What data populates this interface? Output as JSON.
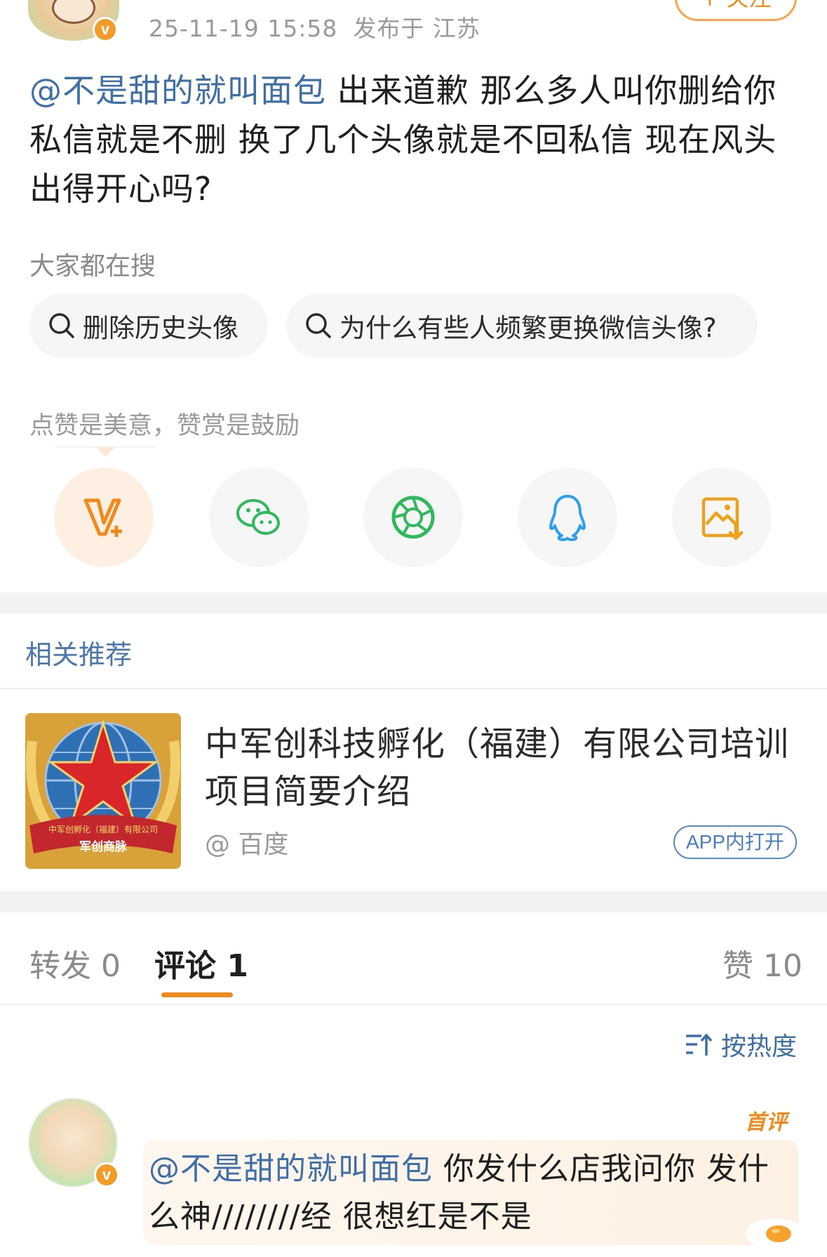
{
  "post": {
    "meta_time": "25-11-19 15:58",
    "meta_location": "发布于 江苏",
    "follow_label": "+ 关注",
    "mention": "@不是甜的就叫面包",
    "body": " 出来道歉 那么多人叫你删给你私信就是不删 换了几个头像就是不回私信 现在风头出得开心吗?"
  },
  "search": {
    "title": "大家都在搜",
    "chips": [
      {
        "label": "删除历史头像",
        "icon": "search-icon"
      },
      {
        "label": "为什么有些人频繁更换微信头像?",
        "icon": "search-icon"
      }
    ]
  },
  "reward": {
    "title": "点赞是美意，赞赏是鼓励",
    "share_icons": [
      "v-plus-icon",
      "wechat-icon",
      "moments-icon",
      "qq-icon",
      "save-image-icon"
    ]
  },
  "related": {
    "title": "相关推荐",
    "card": {
      "title": "中军创科技孵化（福建）有限公司培训项目简要介绍",
      "source": "@ 百度",
      "open_label": "APP内打开",
      "thumb_banner": "中军创孵化（福建）有限公司",
      "thumb_label": "军创商脉"
    }
  },
  "tabs": {
    "repost": "转发 0",
    "comment": "评论 1",
    "like": "赞 10"
  },
  "sort": {
    "label": "按热度",
    "icon": "sort-icon"
  },
  "comment": {
    "badge": "首评",
    "mention": "@不是甜的就叫面包",
    "body": " 你发什么店我问你 发什么神////////经 很想红是不是"
  },
  "colors": {
    "accent_orange": "#f08a1c",
    "link_blue": "#3f6fa7",
    "muted_gray": "#9a9a9a"
  }
}
